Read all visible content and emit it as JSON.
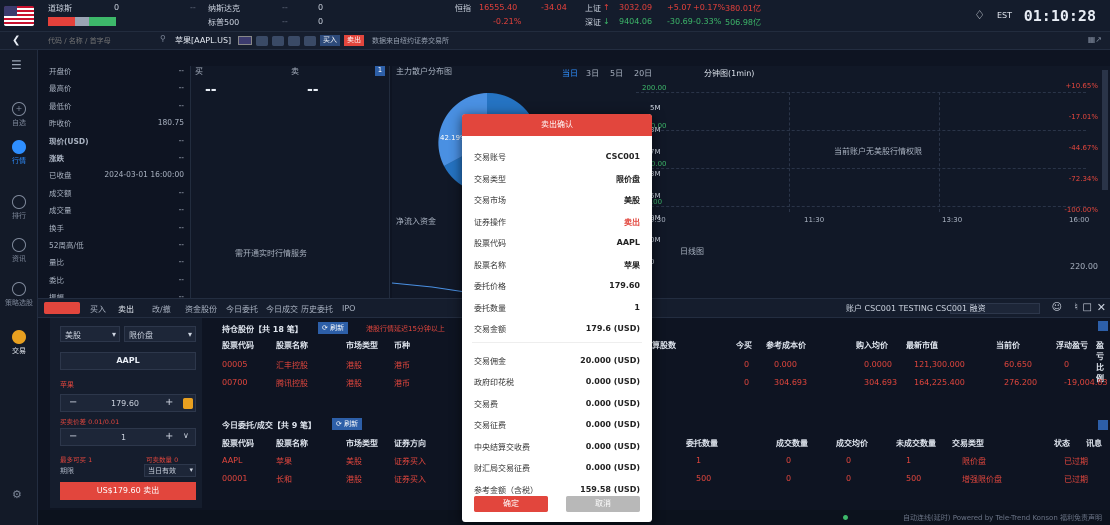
{
  "top": {
    "idx": [
      {
        "name": "道琼斯",
        "val": "0",
        "sub": "--"
      },
      {
        "name": "纳斯达克",
        "val": "0",
        "sub": "--"
      },
      {
        "name": "标普500",
        "val": "0",
        "sub": "--"
      },
      {
        "name": "恒指",
        "val": "16555.40",
        "chg": "-34.04",
        "pct": "-0.21%"
      },
      {
        "name": "上证",
        "val": "3032.09",
        "chg": "+5.07",
        "pct": "+0.17%",
        "amt": "380.01亿"
      },
      {
        "name": "深证",
        "val": "9404.06",
        "chg": "-30.69",
        "pct": "-0.33%",
        "amt": "506.98亿"
      }
    ],
    "tz": "EST",
    "clock": "01:10:28"
  },
  "bar2": {
    "search_placeholder": "代码 / 名称 / 首字母",
    "symbol": "苹果[AAPL.US]",
    "buy": "买入",
    "sell": "卖出",
    "notice": "数据来自纽约证券交易所"
  },
  "side": [
    {
      "label": "自选"
    },
    {
      "label": "行情"
    },
    {
      "label": "排行"
    },
    {
      "label": "资讯"
    },
    {
      "label": "策略选股"
    },
    {
      "label": "交易"
    }
  ],
  "quote": [
    {
      "k": "开盘价",
      "v": "--"
    },
    {
      "k": "最高价",
      "v": "--"
    },
    {
      "k": "最低价",
      "v": "--"
    },
    {
      "k": "昨收价",
      "v": "180.75"
    },
    {
      "k": "现价(USD)",
      "v": "--"
    },
    {
      "k": "涨跌",
      "v": "--"
    },
    {
      "k": "已收盘",
      "v": "2024-03-01 16:00:00"
    },
    {
      "k": "成交额",
      "v": "--"
    },
    {
      "k": "成交量",
      "v": "--"
    },
    {
      "k": "换手",
      "v": "--"
    },
    {
      "k": "52周高/低",
      "v": "--"
    },
    {
      "k": "量比",
      "v": "--"
    },
    {
      "k": "委比",
      "v": "--"
    },
    {
      "k": "振幅",
      "v": "--"
    }
  ],
  "ob": {
    "buy": "买",
    "sell": "卖",
    "bid": "--",
    "ask": "--",
    "notice": "需开通实时行情服务"
  },
  "mid": {
    "title": "主力散户分布图",
    "pct": "42.19%",
    "netflow": "净流入资金"
  },
  "chart": {
    "tabs": [
      "当日",
      "3日",
      "5日",
      "20日"
    ],
    "title": "分钟图(1min)",
    "nodata": "当前账户无美股行情权限",
    "kline": "日线图",
    "yl": [
      "200.00",
      "150.00",
      "100.00",
      "50.00"
    ],
    "yr": [
      "+10.65%",
      "-17.01%",
      "-44.67%",
      "-72.34%",
      "-100.00%"
    ],
    "xt": [
      "9:30",
      "11:30",
      "13:30",
      "16:00"
    ],
    "kval": "220.00",
    "lbl": [
      "5M",
      "3M",
      "7M",
      "3M",
      "5M",
      "0M",
      "0M",
      "0"
    ]
  },
  "tradebar": {
    "tabs": [
      "买入",
      "卖出",
      "改/撤",
      "资金股份",
      "今日委托",
      "今日成交",
      "历史委托",
      "IPO"
    ],
    "account": "账户 CSC001 TESTING CSC001 融资"
  },
  "order": {
    "market": "美股",
    "type": "限价盘",
    "code": "AAPL",
    "name": "苹果",
    "price": "179.60",
    "ask_label": "买卖价差 0.01/0.01",
    "qty": "1",
    "max_buy": "最多可买 1",
    "max_sell": "可卖数量 0",
    "period_label": "期限",
    "period": "当日有效",
    "submit": "US$179.60  卖出"
  },
  "hold": {
    "title": "持仓股份【共 18 笔】",
    "refresh": "刷新",
    "warn": "港股行情延迟15分钟以上",
    "cols": [
      "股票代码",
      "股票名称",
      "市场类型",
      "币种"
    ],
    "rcols": [
      "待结算股数",
      "今买",
      "参考成本价",
      "购入均价",
      "最新市值",
      "当前价",
      "浮动盈亏",
      "盈亏比例"
    ],
    "rows": [
      {
        "code": "00005",
        "name": "汇丰控股",
        "mkt": "港股",
        "cur": "港币",
        "q": "0",
        "b": "0",
        "cost": "0.000",
        "avg": "0.0000",
        "mv": "121,300.000",
        "price": "60.650",
        "pl": "0"
      },
      {
        "code": "00700",
        "name": "腾讯控股",
        "mkt": "港股",
        "cur": "港币",
        "q": "0",
        "b": "0",
        "cost": "304.693",
        "avg": "304.693",
        "mv": "164,225.400",
        "price": "276.200",
        "pl": "-19,004.83"
      }
    ]
  },
  "ord": {
    "title": "今日委托/成交【共 9 笔】",
    "refresh": "刷新",
    "cols": [
      "股票代码",
      "股票名称",
      "市场类型",
      "证券方向"
    ],
    "rcols": [
      "委托数量",
      "成交数量",
      "成交均价",
      "未成交数量",
      "交易类型",
      "状态",
      "讯息"
    ],
    "rows": [
      {
        "code": "AAPL",
        "name": "苹果",
        "mkt": "美股",
        "dir": "证券买入",
        "q": "1",
        "f": "0",
        "fa": "0",
        "u": "1",
        "t": "限价盘",
        "s": "已过期"
      },
      {
        "code": "00001",
        "name": "长和",
        "mkt": "港股",
        "dir": "证券买入",
        "q": "500",
        "f": "0",
        "fa": "0",
        "u": "500",
        "t": "增强限价盘",
        "s": "已过期"
      }
    ]
  },
  "footer": {
    "text": "自动连线(延时)  Powered by Tele-Trend Konson  福利免责声明"
  },
  "modal": {
    "title": "卖出确认",
    "confirm": "确定",
    "cancel": "取消",
    "rows": [
      {
        "k": "交易账号",
        "v": "CSC001"
      },
      {
        "k": "交易类型",
        "v": "限价盘"
      },
      {
        "k": "交易市场",
        "v": "美股"
      },
      {
        "k": "证券操作",
        "v": "卖出"
      },
      {
        "k": "股票代码",
        "v": "AAPL"
      },
      {
        "k": "股票名称",
        "v": "苹果"
      },
      {
        "k": "委托价格",
        "v": "179.60"
      },
      {
        "k": "委托数量",
        "v": "1"
      },
      {
        "k": "交易金额",
        "v": "179.6 (USD)"
      },
      {
        "k": "交易佣金",
        "v": "20.000 (USD)"
      },
      {
        "k": "政府印花税",
        "v": "0.000 (USD)"
      },
      {
        "k": "交易费",
        "v": "0.000 (USD)"
      },
      {
        "k": "交易征费",
        "v": "0.000 (USD)"
      },
      {
        "k": "中央结算交收费",
        "v": "0.000 (USD)"
      },
      {
        "k": "财汇局交易征费",
        "v": "0.000 (USD)"
      },
      {
        "k": "参考金额（含税）",
        "v": "159.58 (USD)"
      }
    ]
  },
  "colors": {
    "accent": "#e2463d",
    "up": "#e5413b",
    "down": "#3db86a",
    "bg": "#0e1422"
  }
}
